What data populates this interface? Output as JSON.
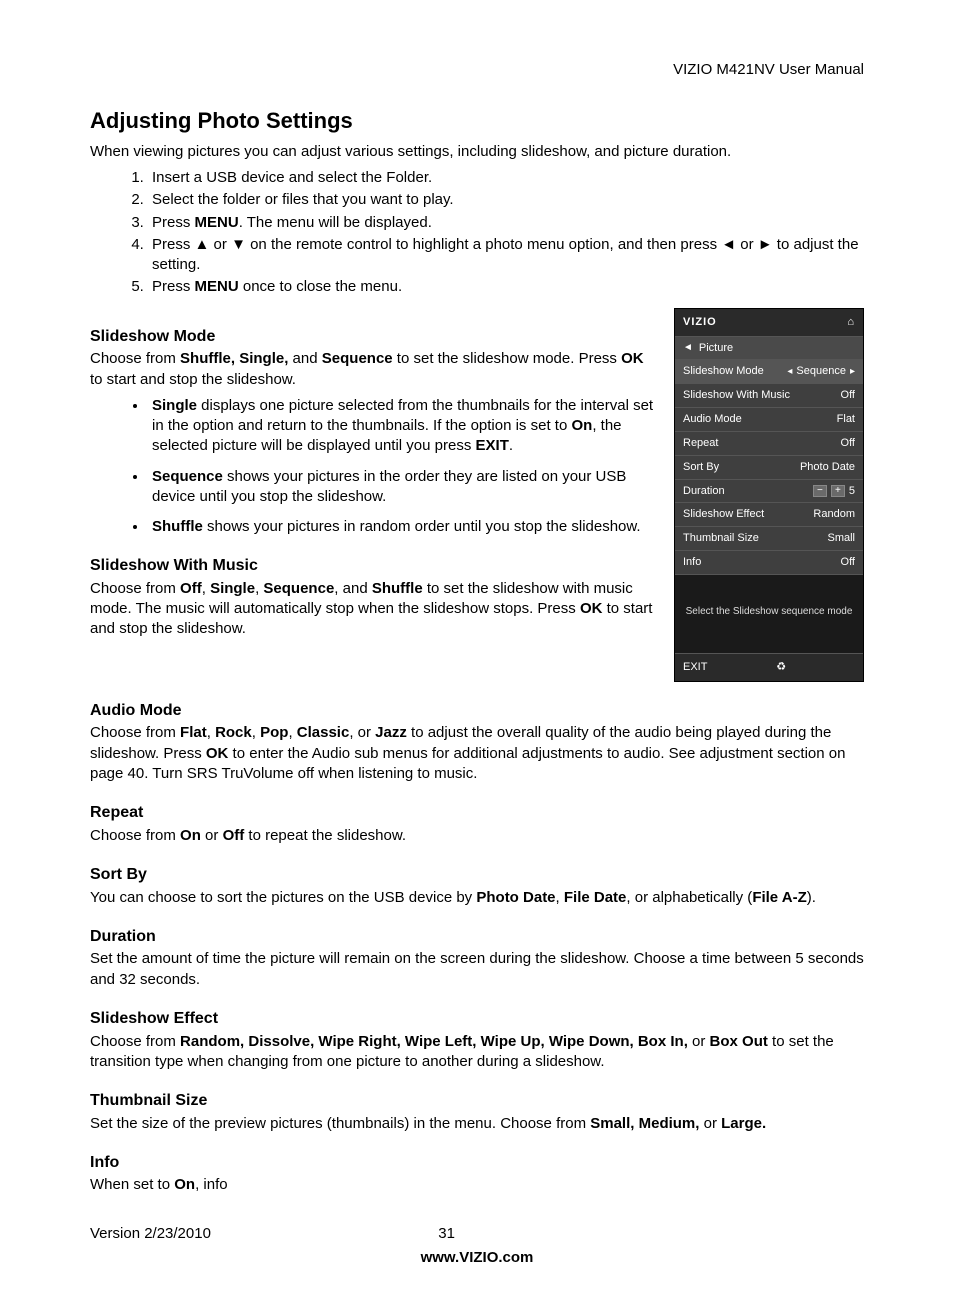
{
  "header": {
    "right": "VIZIO M421NV User Manual"
  },
  "title": "Adjusting Photo Settings",
  "intro": "When viewing pictures you can adjust various settings, including slideshow, and picture duration.",
  "steps": {
    "s1a": "Insert a USB device and select the ",
    "s1b": " Folder.",
    "s2": "Select the folder or files that you want to play.",
    "s3a": "Press ",
    "s3b": "MENU",
    "s3c": ". The ",
    "s3d": " menu will be displayed.",
    "s4a": "Press ",
    "s4b": " or ",
    "s4c": " on the remote control to highlight a photo menu option, and then press ",
    "s4d": " or ",
    "s4e": " to adjust the setting.",
    "s5a": "Press ",
    "s5b": "MENU",
    "s5c": " once to close the menu."
  },
  "glyph": {
    "up": "▲",
    "down": "▼",
    "left": "◄",
    "right": "►"
  },
  "sec": {
    "slideshow_mode": {
      "h": "Slideshow Mode",
      "p1a": "Choose from ",
      "p1b": "Shuffle, Single,",
      "p1c": " and ",
      "p1d": "Sequence",
      "p1e": " to set the slideshow mode. Press ",
      "p1f": "OK",
      "p1g": " to start and stop the slideshow.",
      "b1a": "Single",
      "b1b": " displays one picture selected from the thumbnails for the interval set in the ",
      "b1c": " option and return to the thumbnails. If the ",
      "b1d": " option is set to ",
      "b1e": "On",
      "b1f": ", the selected picture will be displayed until you press ",
      "b1g": "EXIT",
      "b1h": ".",
      "b2a": "Sequence",
      "b2b": " shows your pictures in the order they are listed on your USB device until you stop the slideshow.",
      "b3a": "Shuffle",
      "b3b": " shows your pictures in random order until you stop the slideshow."
    },
    "with_music": {
      "h": "Slideshow With Music",
      "p1a": "Choose from ",
      "p1b": "Off",
      "p1c": ", ",
      "p1d": "Single",
      "p1e": ", ",
      "p1f": "Sequence",
      "p1g": ", and ",
      "p1h": "Shuffle",
      "p1i": " to set the slideshow with music mode. The music will automatically stop when the slideshow stops. Press ",
      "p1j": "OK",
      "p1k": " to start and stop the slideshow."
    },
    "audio": {
      "h": "Audio Mode",
      "p1a": "Choose from ",
      "p1b": "Flat",
      "p1c": ", ",
      "p1d": "Rock",
      "p1e": ", ",
      "p1f": "Pop",
      "p1g": ", ",
      "p1h": "Classic",
      "p1i": ", or ",
      "p1j": "Jazz",
      "p1k": " to adjust the overall quality of the audio being played during the slideshow. Press ",
      "p1l": "OK",
      "p1m": " to enter the Audio sub menus for additional adjustments to audio. See ",
      "p1n": " adjustment section on page 40. Turn SRS TruVolume off when listening to music."
    },
    "repeat": {
      "h": "Repeat",
      "p1a": "Choose from ",
      "p1b": "On",
      "p1c": " or ",
      "p1d": "Off",
      "p1e": " to repeat the slideshow."
    },
    "sortby": {
      "h": "Sort By",
      "p1a": "You can choose to sort the pictures on the USB device by ",
      "p1b": "Photo Date",
      "p1c": ", ",
      "p1d": "File Date",
      "p1e": ", or alphabetically (",
      "p1f": "File A-Z",
      "p1g": ")."
    },
    "duration": {
      "h": "Duration",
      "p": "Set the amount of time the picture will remain on the screen during the slideshow. Choose a time between 5 seconds and 32 seconds."
    },
    "effect": {
      "h": "Slideshow Effect",
      "p1a": "Choose from ",
      "p1b": "Random, Dissolve, Wipe Right, Wipe Left, Wipe Up, Wipe Down, Box In,",
      "p1c": " or ",
      "p1d": "Box Out",
      "p1e": " to set the transition type when changing from one picture to another during a slideshow."
    },
    "thumb": {
      "h": "Thumbnail Size",
      "p1a": "Set the size of the preview pictures (thumbnails) in the menu. Choose from ",
      "p1b": "Small, Medium,",
      "p1c": " or ",
      "p1d": "Large."
    },
    "info": {
      "h": "Info",
      "p1a": "When set to ",
      "p1b": "On",
      "p1c": ", info"
    }
  },
  "menu": {
    "brand": "VIZIO",
    "crumb_arrow": "◄",
    "crumb": "Picture",
    "home_icon": "⌂",
    "rows": [
      {
        "label": "Slideshow Mode",
        "value": "Sequence",
        "active": true,
        "arrows": true
      },
      {
        "label": "Slideshow With Music",
        "value": "Off"
      },
      {
        "label": "Audio Mode",
        "value": "Flat"
      },
      {
        "label": "Repeat",
        "value": "Off"
      },
      {
        "label": "Sort By",
        "value": "Photo Date"
      },
      {
        "label": "Duration",
        "value": "5",
        "stepper": true
      },
      {
        "label": "Slideshow Effect",
        "value": "Random"
      },
      {
        "label": "Thumbnail Size",
        "value": "Small"
      },
      {
        "label": "Info",
        "value": "Off"
      }
    ],
    "help": "Select the Slideshow sequence mode",
    "exit": "EXIT",
    "footer_icon": "♻"
  },
  "footer": {
    "version": "Version 2/23/2010",
    "page": "31",
    "url": "www.VIZIO.com"
  }
}
